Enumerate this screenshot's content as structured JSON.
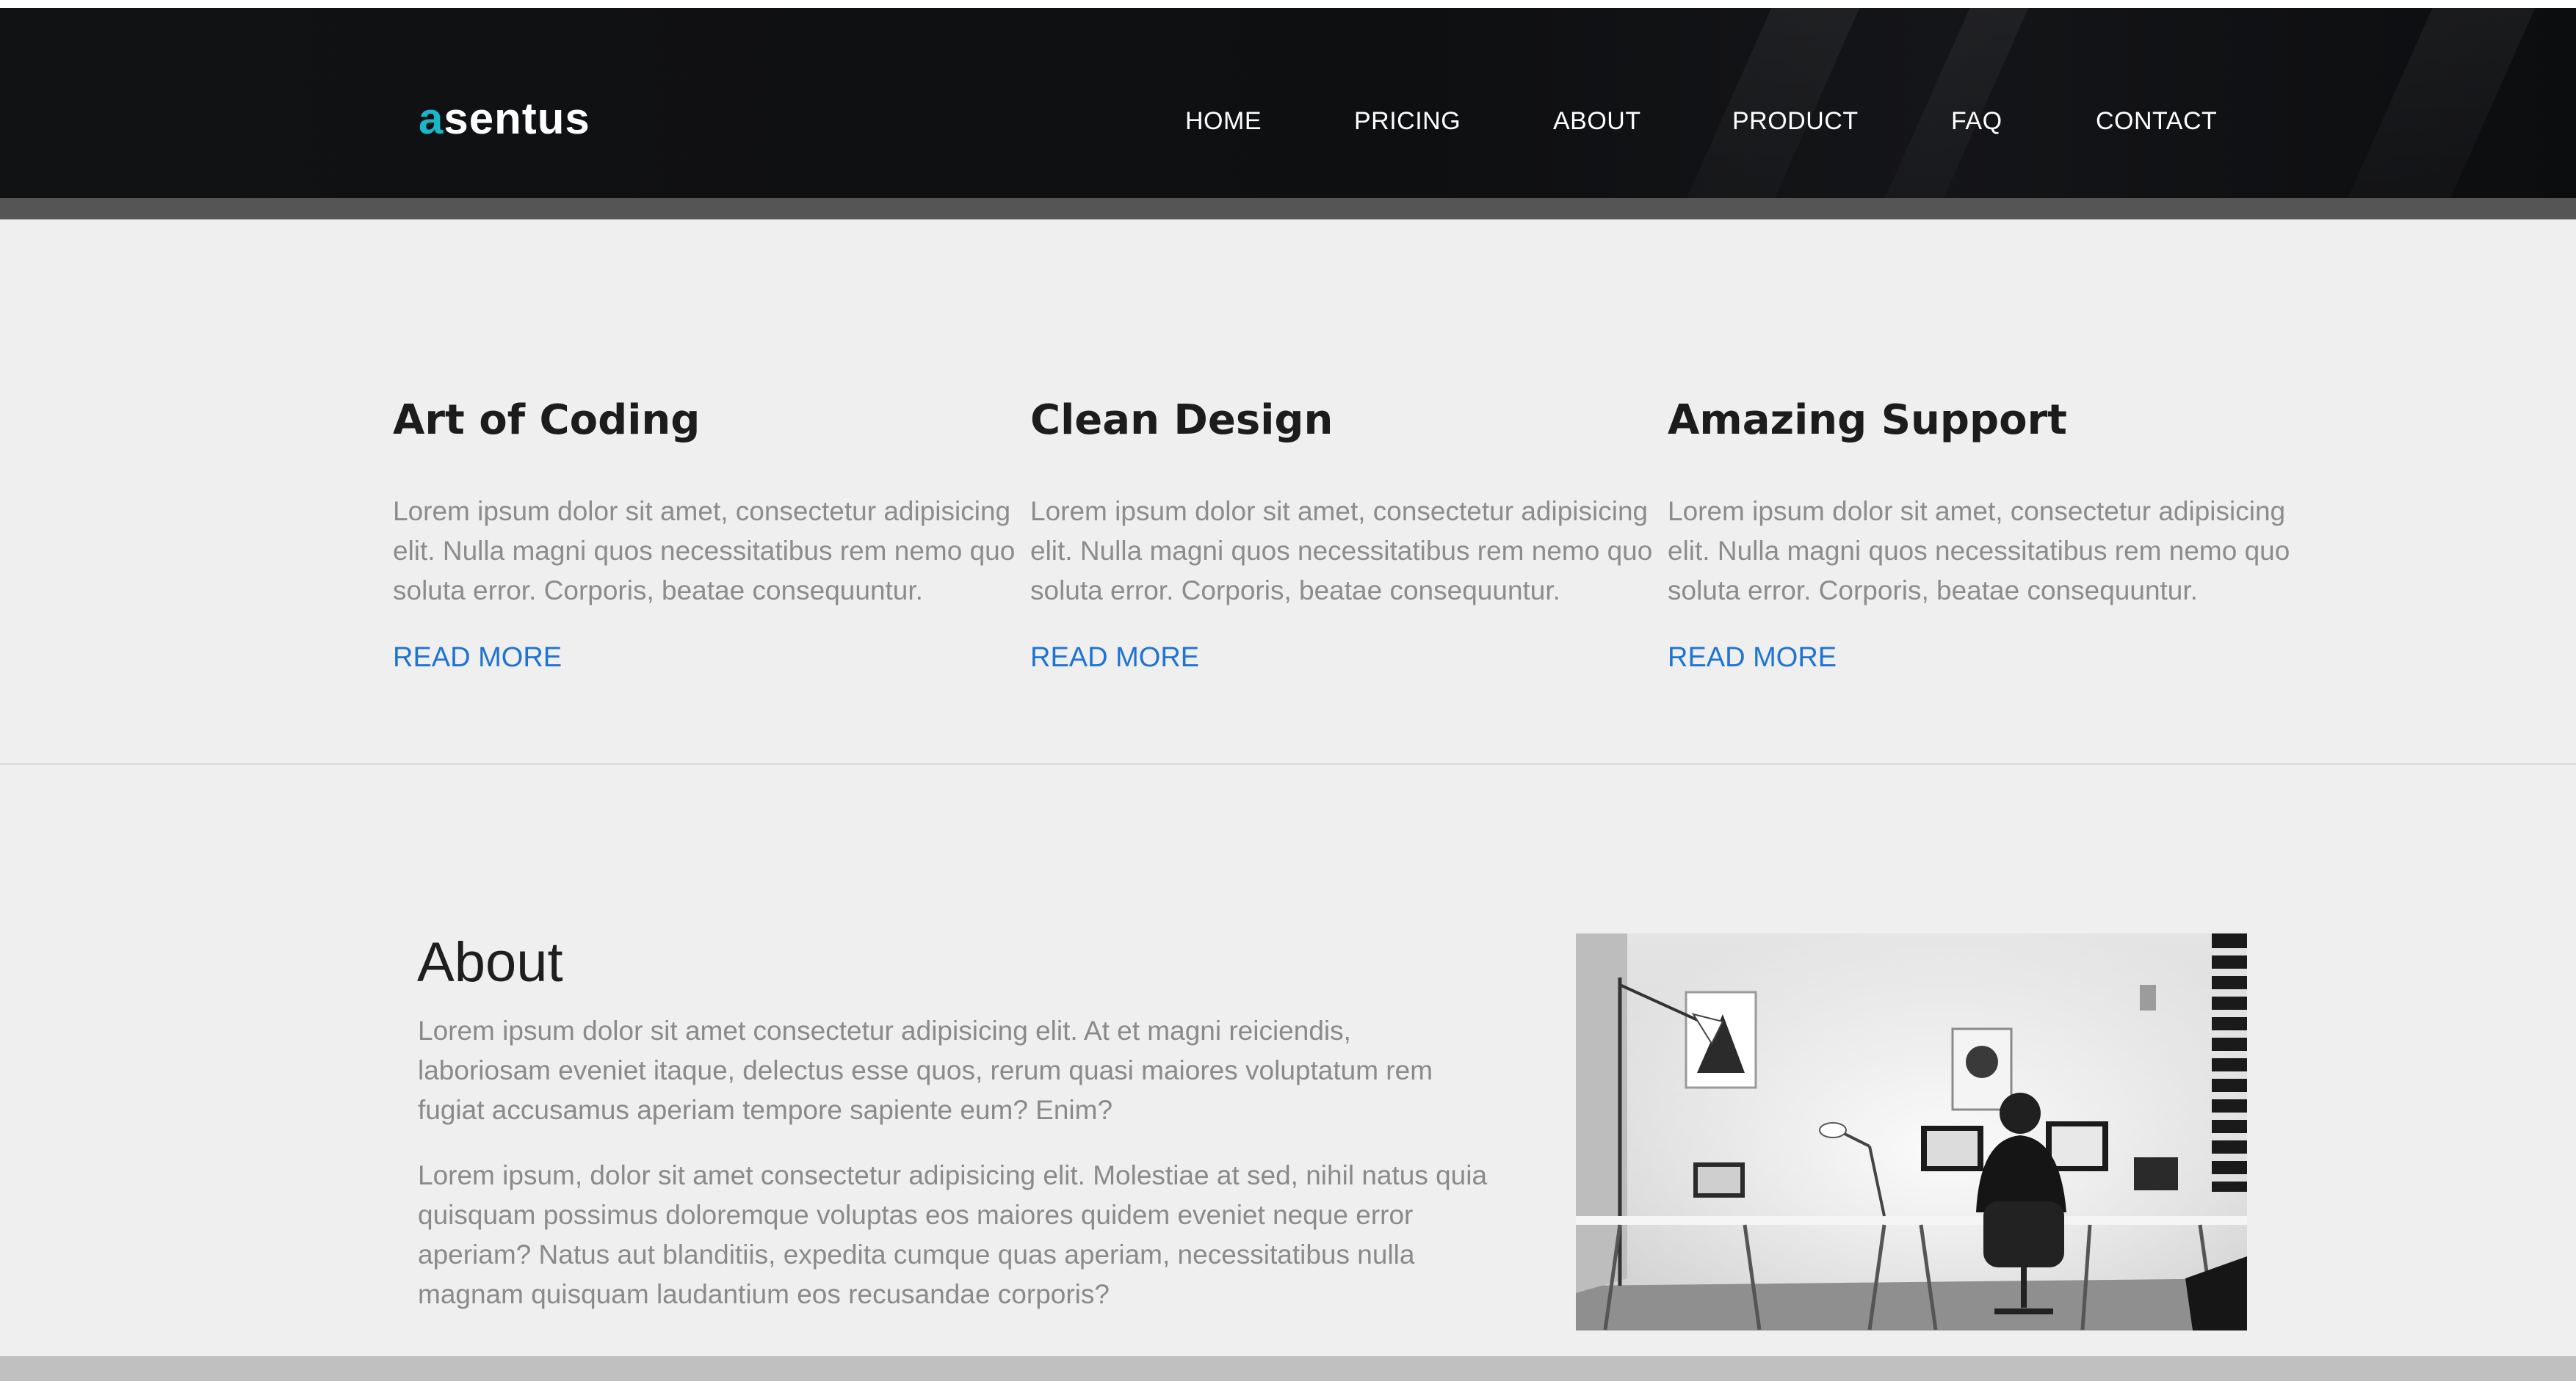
{
  "brand": {
    "first_letter": "a",
    "rest": "sentus",
    "accent_color": "#19b6c9"
  },
  "nav": {
    "items": [
      {
        "label": "HOME"
      },
      {
        "label": "PRICING"
      },
      {
        "label": "ABOUT"
      },
      {
        "label": "PRODUCT"
      },
      {
        "label": "FAQ"
      },
      {
        "label": "CONTACT"
      }
    ]
  },
  "features": [
    {
      "title": "Art of Coding",
      "text": "Lorem ipsum dolor sit amet, consectetur adipisicing elit. Nulla magni quos necessitatibus rem nemo quo soluta error. Corporis, beatae consequuntur.",
      "link": "READ MORE"
    },
    {
      "title": "Clean Design",
      "text": "Lorem ipsum dolor sit amet, consectetur adipisicing elit. Nulla magni quos necessitatibus rem nemo quo soluta error. Corporis, beatae consequuntur.",
      "link": "READ MORE"
    },
    {
      "title": "Amazing Support",
      "text": "Lorem ipsum dolor sit amet, consectetur adipisicing elit. Nulla magni quos necessitatibus rem nemo quo soluta error. Corporis, beatae consequuntur.",
      "link": "READ MORE"
    }
  ],
  "about": {
    "title": "About",
    "paragraph1": "Lorem ipsum dolor sit amet consectetur adipisicing elit. At et magni reiciendis, laboriosam eveniet itaque, delectus esse quos, rerum quasi maiores voluptatum rem fugiat accusamus aperiam tempore sapiente eum? Enim?",
    "paragraph2": "Lorem ipsum, dolor sit amet consectetur adipisicing elit. Molestiae at sed, nihil natus quia quisquam possimus doloremque voluptas eos maiores quidem eveniet neque error aperiam? Natus aut blanditiis, expedita cumque quas aperiam, necessitatibus nulla magnam quisquam laudantium eos recusandae corporis?",
    "image_icon": "office-workspace-photo"
  },
  "colors": {
    "header_bg": "#0f1012",
    "link": "#1e74d4",
    "body_text": "#8c8c8c",
    "heading": "#1c1c1c"
  }
}
